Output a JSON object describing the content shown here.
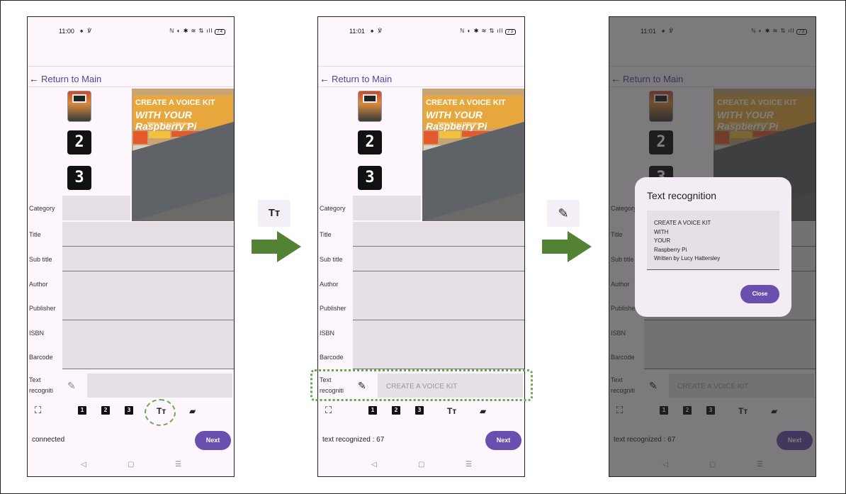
{
  "theme": {
    "accent": "#6b4fae",
    "highlight": "#6aa84f",
    "arrow": "#548235"
  },
  "screens": [
    {
      "time": "11:00",
      "time_icons": "♠ ℣",
      "sys_icons": "ℕ ◐ ✱ ≋ ⇅ ıll",
      "battery": "74",
      "back_label": "Return to Main",
      "thumbs": [
        "2",
        "3"
      ],
      "fields": [
        "Category",
        "Title",
        "Sub title",
        "Author",
        "Publisher",
        "ISBN",
        "Barcode"
      ],
      "text_label": "Text recogniti",
      "text_value": "",
      "toolbar": {
        "scan": "⛶",
        "b1": "1",
        "b2": "2",
        "b3": "3",
        "tt": "Tт",
        "gun": "▰"
      },
      "status": "connected",
      "next": "Next",
      "nav": {
        "back": "◁",
        "home": "▢",
        "menu": "☰"
      }
    },
    {
      "time": "11:01",
      "time_icons": "♠ ℣",
      "sys_icons": "ℕ ◐ ✱ ≋ ⇅ ıll",
      "battery": "73",
      "back_label": "Return to Main",
      "thumbs": [
        "2",
        "3"
      ],
      "fields": [
        "Category",
        "Title",
        "Sub title",
        "Author",
        "Publisher",
        "ISBN",
        "Barcode"
      ],
      "text_label": "Text recogniti",
      "text_value": "CREATE A VOICE KIT",
      "toolbar": {
        "scan": "⛶",
        "b1": "1",
        "b2": "2",
        "b3": "3",
        "tt": "Tт",
        "gun": "▰"
      },
      "status": "text recognized : 67",
      "next": "Next",
      "nav": {
        "back": "◁",
        "home": "▢",
        "menu": "☰"
      }
    },
    {
      "time": "11:01",
      "time_icons": "♠ ℣",
      "sys_icons": "ℕ ◐ ✱ ≋ ⇅ ıll",
      "battery": "73",
      "back_label": "Return to Main",
      "thumbs": [
        "2",
        "3"
      ],
      "fields": [
        "Category",
        "Title",
        "Sub title",
        "Author",
        "Publisher",
        "ISBN",
        "Barcode"
      ],
      "text_label": "Text recogniti",
      "text_value": "CREATE A VOICE KIT",
      "toolbar": {
        "scan": "⛶",
        "b1": "1",
        "b2": "2",
        "b3": "3",
        "tt": "Tт",
        "gun": "▰"
      },
      "status": "text recognized : 67",
      "next": "Next",
      "nav": {
        "back": "◁",
        "home": "▢",
        "menu": "☰"
      },
      "dialog": {
        "title": "Text recognition",
        "content": "CREATE A VOICE KIT\nWITH\nYOUR\nRaspberry Pi\nWritten by Lucy Hattersley",
        "close": "Close"
      }
    }
  ],
  "camera": {
    "line1": "CREATE A VOICE KIT",
    "line2": "WITH YOUR Raspberry Pi",
    "line3": "Written by Lucy Hattersley"
  },
  "between_icons": {
    "text_tool": "Tт",
    "edit_tool": "✎"
  }
}
